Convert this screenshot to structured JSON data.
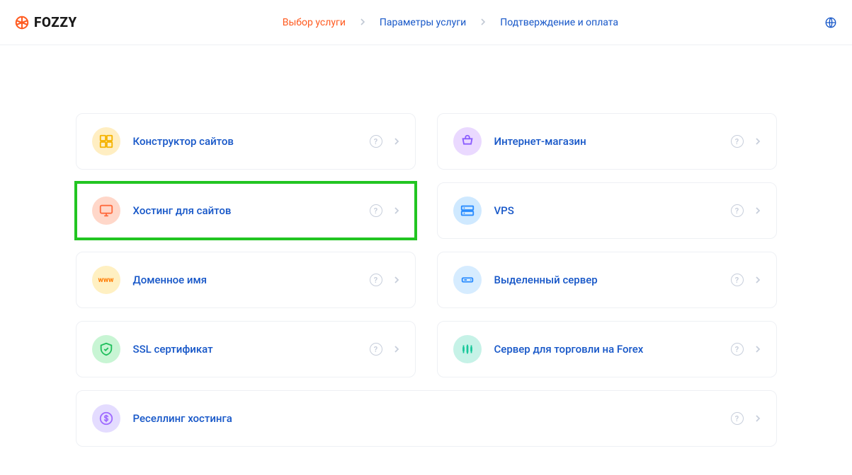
{
  "logo_text": "FOZZY",
  "breadcrumbs": [
    {
      "label": "Выбор услуги",
      "active": true
    },
    {
      "label": "Параметры услуги",
      "active": false
    },
    {
      "label": "Подтверждение и оплата",
      "active": false
    }
  ],
  "services": [
    {
      "id": "site-builder",
      "label": "Конструктор сайтов",
      "icon": "grid-icon",
      "bg": "bg-yellow",
      "wide": false,
      "highlight": false
    },
    {
      "id": "ecommerce",
      "label": "Интернет-магазин",
      "icon": "cart-icon",
      "bg": "bg-purple2",
      "wide": false,
      "highlight": false
    },
    {
      "id": "hosting",
      "label": "Хостинг для сайтов",
      "icon": "monitor-icon",
      "bg": "bg-peach",
      "wide": false,
      "highlight": true
    },
    {
      "id": "vps",
      "label": "VPS",
      "icon": "server-icon",
      "bg": "bg-sky",
      "wide": false,
      "highlight": false
    },
    {
      "id": "domain",
      "label": "Доменное имя",
      "icon": "www-icon",
      "bg": "bg-cream",
      "wide": false,
      "highlight": false
    },
    {
      "id": "dedicated",
      "label": "Выделенный сервер",
      "icon": "rack-icon",
      "bg": "bg-sky2",
      "wide": false,
      "highlight": false
    },
    {
      "id": "ssl",
      "label": "SSL сертификат",
      "icon": "shield-icon",
      "bg": "bg-mint",
      "wide": false,
      "highlight": false
    },
    {
      "id": "forex",
      "label": "Сервер для торговли на Forex",
      "icon": "candles-icon",
      "bg": "bg-teal",
      "wide": false,
      "highlight": false
    },
    {
      "id": "reselling",
      "label": "Реселлинг хостинга",
      "icon": "dollar-icon",
      "bg": "bg-lilac",
      "wide": true,
      "highlight": false
    }
  ]
}
